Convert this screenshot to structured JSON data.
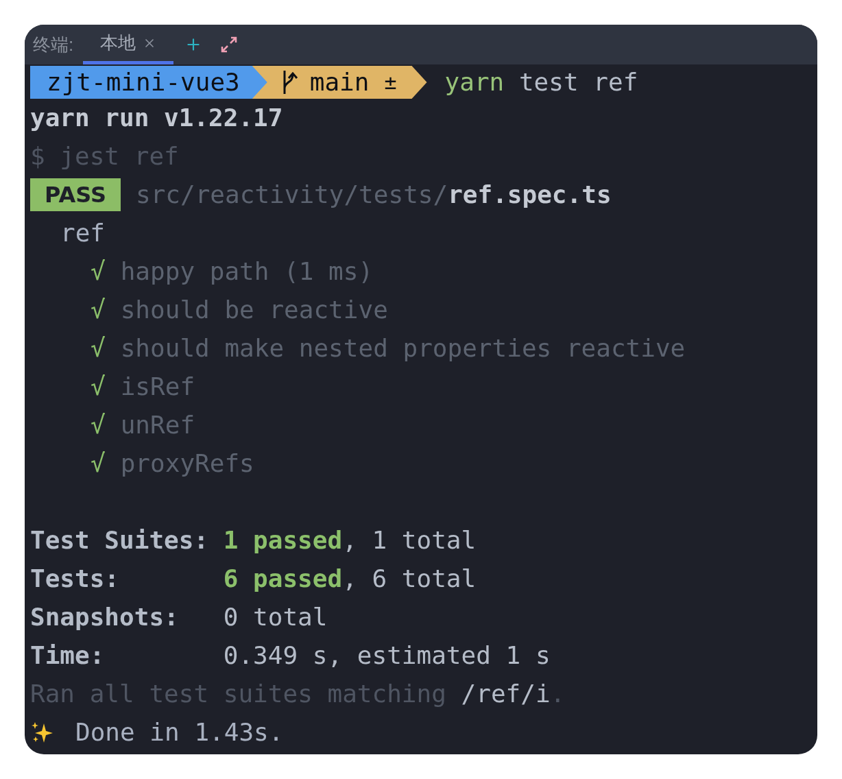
{
  "tab_bar": {
    "label": "终端:",
    "tabs": [
      {
        "label": "本地",
        "selected": true
      }
    ]
  },
  "prompt": {
    "directory": "zjt-mini-vue3",
    "branch": "main",
    "branch_status": "±",
    "program": "yarn",
    "args": "test ref"
  },
  "output": [
    {
      "kind": "header",
      "text": "yarn run v1.22.17"
    },
    {
      "kind": "dim",
      "text": "$ jest ref"
    },
    {
      "kind": "pass",
      "badge": "PASS",
      "path": "src/reactivity/tests/",
      "file": "ref.spec.ts"
    },
    {
      "kind": "suite",
      "text": "ref"
    },
    {
      "kind": "test",
      "mark": "√",
      "text": "happy path (1 ms)"
    },
    {
      "kind": "test",
      "mark": "√",
      "text": "should be reactive"
    },
    {
      "kind": "test",
      "mark": "√",
      "text": "should make nested properties reactive"
    },
    {
      "kind": "test",
      "mark": "√",
      "text": "isRef"
    },
    {
      "kind": "test",
      "mark": "√",
      "text": "unRef"
    },
    {
      "kind": "test",
      "mark": "√",
      "text": "proxyRefs"
    },
    {
      "kind": "blank"
    },
    {
      "kind": "summary",
      "label": "Test Suites:",
      "passed": "1 passed",
      "rest": ", 1 total"
    },
    {
      "kind": "summary",
      "label": "Tests:",
      "passed": "6 passed",
      "rest": ", 6 total"
    },
    {
      "kind": "summary",
      "label": "Snapshots:",
      "rest": "0 total"
    },
    {
      "kind": "summary",
      "label": "Time:",
      "rest": "0.349 s, estimated 1 s"
    },
    {
      "kind": "ran",
      "text": "Ran all test suites matching ",
      "pattern": "/ref/i",
      "tail": "."
    },
    {
      "kind": "done",
      "text": "Done in 1.43s."
    }
  ]
}
